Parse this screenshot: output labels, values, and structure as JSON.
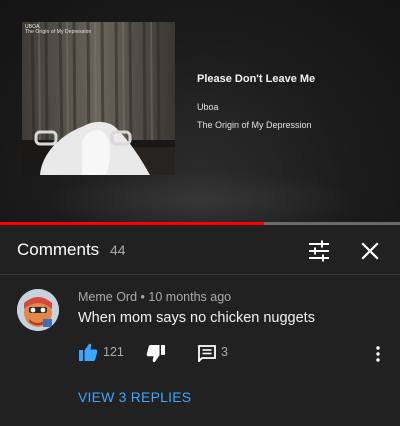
{
  "video": {
    "album_art": {
      "label_line1": "UBOA",
      "label_line2": "The Origin of My Depression"
    },
    "track_title": "Please Don't Leave Me",
    "artist": "Uboa",
    "album": "The Origin of My Depression",
    "progress_fraction": 0.66,
    "progress_color": "#ff0000"
  },
  "comments_panel": {
    "title": "Comments",
    "count": "44",
    "sort_icon": "sort-filter-icon",
    "close_icon": "close-icon"
  },
  "comment": {
    "author": "Meme Ord",
    "separator": "•",
    "time": "10 months ago",
    "text": "When mom says no chicken nuggets",
    "likes": "121",
    "replies": "3",
    "view_replies_label": "VIEW 3 REPLIES",
    "accent_color": "#3ea6ff"
  }
}
